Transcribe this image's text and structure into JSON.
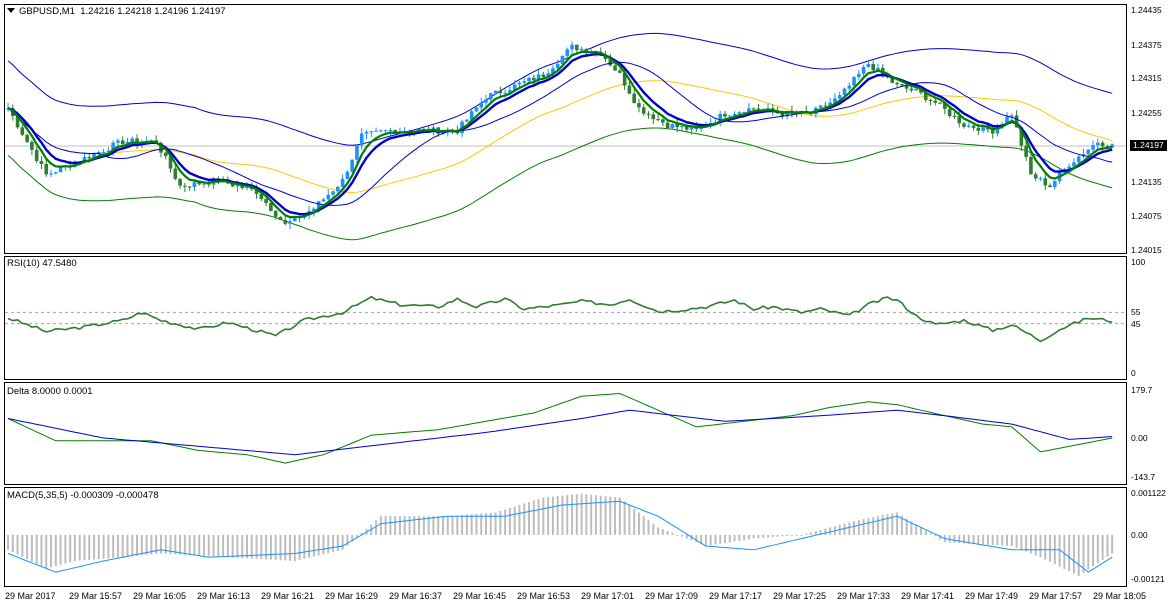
{
  "header": {
    "symbol": "GBPUSD,M1",
    "ohlc": "1.24216 1.24218 1.24196 1.24197"
  },
  "current_price_label": "1.24197",
  "colors": {
    "bull": "#1e90ff",
    "bear": "#2e7d32",
    "ma_blue": "#0000cd",
    "ma_green": "#008000",
    "ma_yellow": "#ffc800",
    "rsi_line": "#2e7d32",
    "hist": "#bdbdbd",
    "macd_signal": "#1e90ff",
    "grid_dash": "#a0a0a0"
  },
  "chart_data": [
    {
      "type": "candlestick",
      "title": "GBPUSD,M1",
      "ylim": [
        1.24,
        1.2445
      ],
      "y_ticks": [
        "1.24435",
        "1.24375",
        "1.24315",
        "1.24255",
        "1.24197",
        "1.24135",
        "1.24075",
        "1.24015"
      ],
      "x_ticks": [
        "29 Mar 2017",
        "29 Mar 15:57",
        "29 Mar 16:05",
        "29 Mar 16:13",
        "29 Mar 16:21",
        "29 Mar 16:29",
        "29 Mar 16:37",
        "29 Mar 16:45",
        "29 Mar 16:53",
        "29 Mar 17:01",
        "29 Mar 17:09",
        "29 Mar 17:17",
        "29 Mar 17:25",
        "29 Mar 17:33",
        "29 Mar 17:41",
        "29 Mar 17:49",
        "29 Mar 17:57",
        "29 Mar 18:05"
      ],
      "close_keypoints": [
        [
          0,
          1.24265
        ],
        [
          8,
          1.24145
        ],
        [
          16,
          1.24175
        ],
        [
          24,
          1.24205
        ],
        [
          31,
          1.24205
        ],
        [
          36,
          1.24125
        ],
        [
          44,
          1.24135
        ],
        [
          52,
          1.24115
        ],
        [
          58,
          1.24055
        ],
        [
          64,
          1.24085
        ],
        [
          70,
          1.24135
        ],
        [
          74,
          1.24215
        ],
        [
          80,
          1.24225
        ],
        [
          88,
          1.24225
        ],
        [
          94,
          1.24225
        ],
        [
          100,
          1.24285
        ],
        [
          106,
          1.24305
        ],
        [
          112,
          1.24325
        ],
        [
          118,
          1.24375
        ],
        [
          124,
          1.24365
        ],
        [
          128,
          1.24325
        ],
        [
          132,
          1.24265
        ],
        [
          138,
          1.24235
        ],
        [
          144,
          1.24225
        ],
        [
          150,
          1.24255
        ],
        [
          156,
          1.24265
        ],
        [
          162,
          1.24255
        ],
        [
          168,
          1.24255
        ],
        [
          174,
          1.24285
        ],
        [
          180,
          1.24345
        ],
        [
          186,
          1.24305
        ],
        [
          190,
          1.24295
        ],
        [
          194,
          1.24275
        ],
        [
          200,
          1.24235
        ],
        [
          206,
          1.24225
        ],
        [
          210,
          1.24255
        ],
        [
          214,
          1.24145
        ],
        [
          218,
          1.24125
        ],
        [
          222,
          1.24165
        ],
        [
          228,
          1.24205
        ],
        [
          231,
          1.24197
        ]
      ],
      "overlays": [
        {
          "name": "ma_thin_blue",
          "style": "thin",
          "color": "#0000cd"
        },
        {
          "name": "ma_thick_blue",
          "style": "thick",
          "color": "#0000cd"
        },
        {
          "name": "ma_green",
          "style": "medium",
          "color": "#008000"
        },
        {
          "name": "ma_yellow",
          "style": "thin",
          "color": "#ffc800"
        },
        {
          "name": "env_upper",
          "style": "thin",
          "color": "#0000cd"
        },
        {
          "name": "env_lower",
          "style": "thin",
          "color": "#008000"
        }
      ]
    },
    {
      "type": "line",
      "title": "RSI(10) 47.5480",
      "ylim": [
        0,
        100
      ],
      "levels": [
        45,
        55
      ],
      "y_ticks": [
        "100",
        "55",
        "45",
        "0"
      ],
      "keypoints": [
        [
          0,
          50
        ],
        [
          8,
          38
        ],
        [
          16,
          42
        ],
        [
          24,
          48
        ],
        [
          28,
          55
        ],
        [
          32,
          48
        ],
        [
          40,
          40
        ],
        [
          46,
          46
        ],
        [
          56,
          34
        ],
        [
          62,
          48
        ],
        [
          70,
          55
        ],
        [
          76,
          68
        ],
        [
          82,
          62
        ],
        [
          90,
          60
        ],
        [
          94,
          67
        ],
        [
          98,
          60
        ],
        [
          104,
          67
        ],
        [
          108,
          58
        ],
        [
          116,
          62
        ],
        [
          120,
          65
        ],
        [
          126,
          62
        ],
        [
          130,
          67
        ],
        [
          136,
          56
        ],
        [
          140,
          57
        ],
        [
          146,
          60
        ],
        [
          152,
          66
        ],
        [
          156,
          58
        ],
        [
          160,
          60
        ],
        [
          166,
          55
        ],
        [
          170,
          58
        ],
        [
          176,
          52
        ],
        [
          180,
          62
        ],
        [
          184,
          68
        ],
        [
          186,
          66
        ],
        [
          190,
          52
        ],
        [
          194,
          44
        ],
        [
          200,
          48
        ],
        [
          206,
          39
        ],
        [
          210,
          44
        ],
        [
          216,
          30
        ],
        [
          220,
          40
        ],
        [
          226,
          50
        ],
        [
          231,
          47.5
        ]
      ]
    },
    {
      "type": "line",
      "title": "Delta 8.0000 0.0001",
      "ylim": [
        -143.7,
        179.7
      ],
      "y_ticks": [
        "179.7",
        "0.00",
        "-143.7"
      ],
      "series": [
        {
          "color": "#008000",
          "keypoints": [
            [
              0,
              70
            ],
            [
              10,
              -10
            ],
            [
              20,
              -10
            ],
            [
              30,
              -10
            ],
            [
              40,
              -45
            ],
            [
              50,
              -60
            ],
            [
              58,
              -90
            ],
            [
              66,
              -60
            ],
            [
              76,
              10
            ],
            [
              90,
              30
            ],
            [
              100,
              60
            ],
            [
              110,
              90
            ],
            [
              120,
              150
            ],
            [
              128,
              160
            ],
            [
              136,
              100
            ],
            [
              144,
              40
            ],
            [
              154,
              60
            ],
            [
              164,
              80
            ],
            [
              172,
              110
            ],
            [
              180,
              130
            ],
            [
              186,
              120
            ],
            [
              196,
              80
            ],
            [
              204,
              50
            ],
            [
              210,
              40
            ],
            [
              216,
              -50
            ],
            [
              222,
              -30
            ],
            [
              231,
              0
            ]
          ]
        },
        {
          "color": "#0000cd",
          "keypoints": [
            [
              0,
              70
            ],
            [
              20,
              0
            ],
            [
              40,
              -30
            ],
            [
              60,
              -60
            ],
            [
              80,
              -20
            ],
            [
              100,
              20
            ],
            [
              120,
              70
            ],
            [
              130,
              100
            ],
            [
              140,
              80
            ],
            [
              150,
              60
            ],
            [
              170,
              80
            ],
            [
              186,
              100
            ],
            [
              196,
              80
            ],
            [
              210,
              50
            ],
            [
              222,
              -5
            ],
            [
              231,
              5
            ]
          ]
        }
      ]
    },
    {
      "type": "bar",
      "title": "MACD(5,35,5) -0.000309 -0.000478",
      "ylim": [
        -0.00121,
        0.001122
      ],
      "y_ticks": [
        "0.001122",
        "0.00",
        "-0.00121"
      ],
      "hist_keypoints": [
        [
          0,
          -0.0004
        ],
        [
          8,
          -0.0009
        ],
        [
          14,
          -0.0007
        ],
        [
          24,
          -0.0006
        ],
        [
          32,
          -0.0005
        ],
        [
          46,
          -0.0006
        ],
        [
          60,
          -0.0007
        ],
        [
          70,
          -0.0004
        ],
        [
          78,
          0.0005
        ],
        [
          92,
          0.0005
        ],
        [
          102,
          0.0006
        ],
        [
          112,
          0.001
        ],
        [
          120,
          0.0011
        ],
        [
          128,
          0.001
        ],
        [
          136,
          0.0002
        ],
        [
          146,
          -0.0003
        ],
        [
          156,
          -0.0001
        ],
        [
          166,
          0.0
        ],
        [
          178,
          0.0004
        ],
        [
          186,
          0.0006
        ],
        [
          196,
          -0.0002
        ],
        [
          210,
          -0.0003
        ],
        [
          216,
          -0.0006
        ],
        [
          224,
          -0.0011
        ],
        [
          231,
          -0.0005
        ]
      ],
      "signal_keypoints": [
        [
          0,
          -0.0005
        ],
        [
          10,
          -0.001
        ],
        [
          20,
          -0.0007
        ],
        [
          32,
          -0.0004
        ],
        [
          42,
          -0.0006
        ],
        [
          60,
          -0.0005
        ],
        [
          70,
          -0.0003
        ],
        [
          78,
          0.0003
        ],
        [
          92,
          0.0005
        ],
        [
          104,
          0.0005
        ],
        [
          116,
          0.0008
        ],
        [
          128,
          0.0009
        ],
        [
          136,
          0.0005
        ],
        [
          146,
          -0.0003
        ],
        [
          156,
          -0.0004
        ],
        [
          166,
          -0.0001
        ],
        [
          176,
          0.0002
        ],
        [
          186,
          0.0005
        ],
        [
          196,
          -0.0001
        ],
        [
          210,
          -0.0004
        ],
        [
          220,
          -0.0004
        ],
        [
          226,
          -0.001
        ],
        [
          231,
          -0.0006
        ]
      ]
    }
  ]
}
